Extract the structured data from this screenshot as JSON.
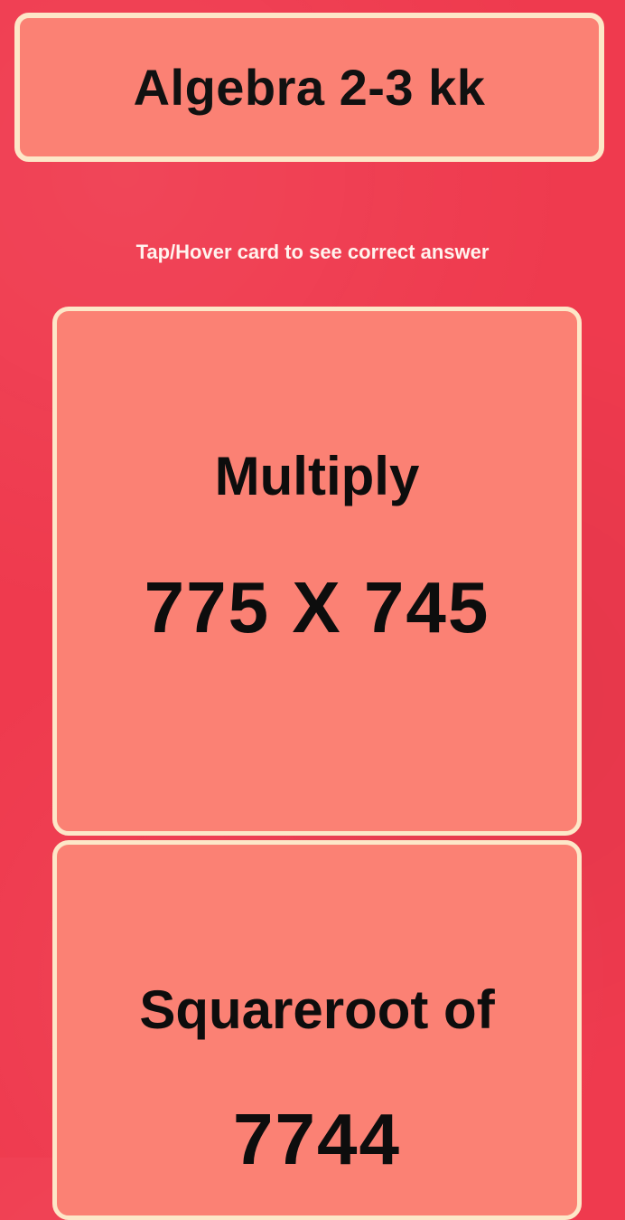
{
  "header": {
    "title": "Algebra 2-3 kk"
  },
  "hint": "Tap/Hover card to see correct answer",
  "cards": [
    {
      "operation": "Multiply",
      "value": "775 X 745"
    },
    {
      "operation": "Squareroot of",
      "value": "7744"
    }
  ],
  "colors": {
    "background": "#ef3a4e",
    "card": "#fb8174",
    "border": "#fde7c8",
    "text": "#111111"
  }
}
